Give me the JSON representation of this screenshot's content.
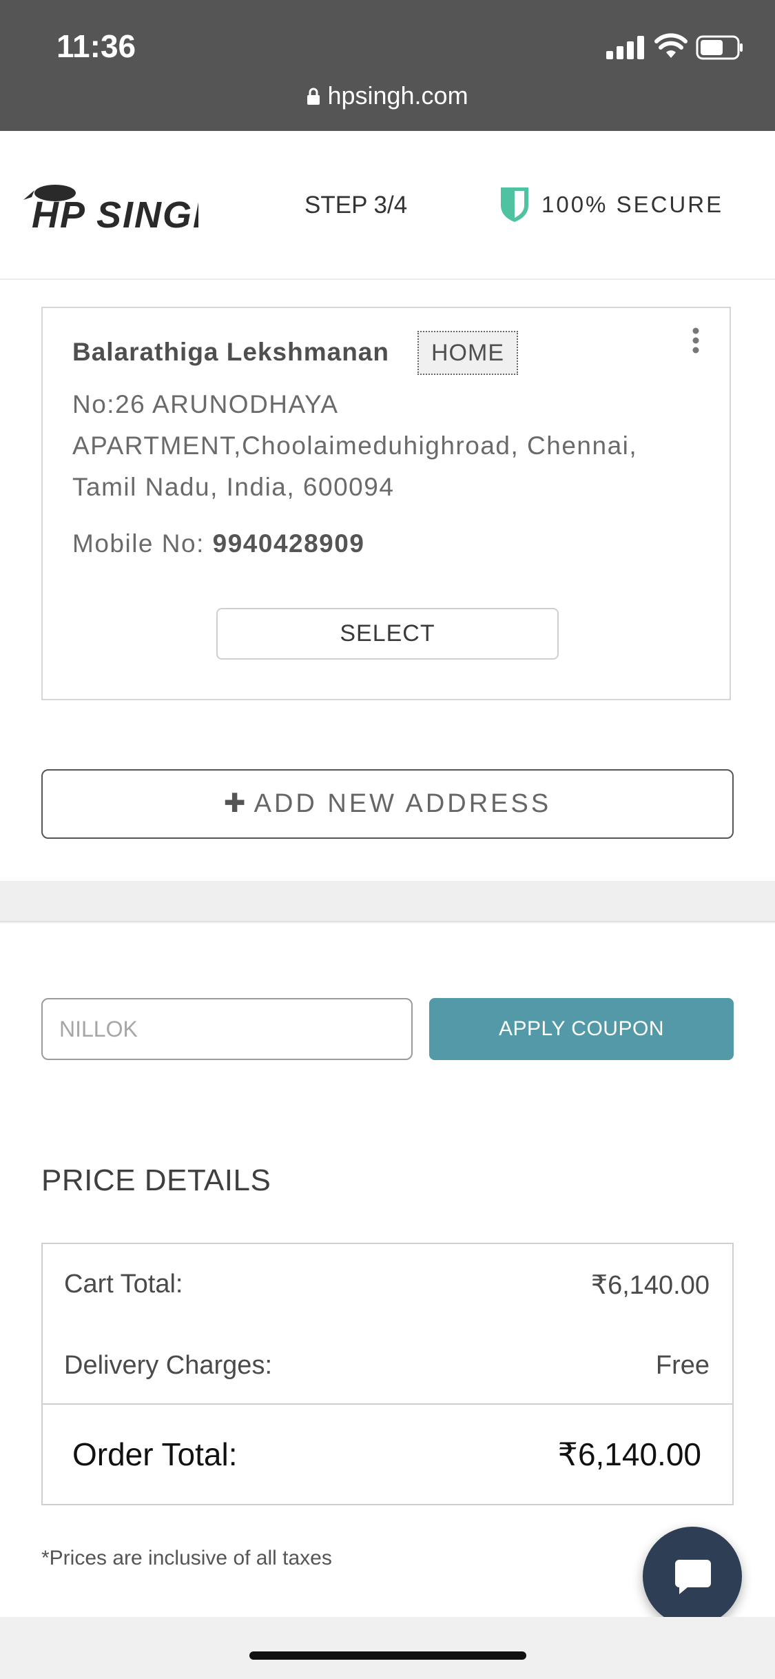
{
  "status_bar": {
    "time": "11:36",
    "url": "hpsingh.com"
  },
  "header": {
    "step": "STEP 3/4",
    "secure": "100% SECURE"
  },
  "address": {
    "name": "Balarathiga Lekshmanan",
    "tag": "HOME",
    "line1": "No:26 ARUNODHAYA",
    "line2": "APARTMENT,Choolaimeduhighroad, Chennai,",
    "line3": "Tamil Nadu, India, 600094",
    "mobile_label": "Mobile No: ",
    "mobile_value": "9940428909",
    "select_label": "SELECT"
  },
  "add_address_label": "ADD NEW ADDRESS",
  "coupon": {
    "placeholder": "NILLOK",
    "apply_label": "APPLY COUPON"
  },
  "price_details": {
    "title": "PRICE DETAILS",
    "cart_total_label": "Cart Total:",
    "cart_total_value": "₹6,140.00",
    "delivery_label": "Delivery Charges:",
    "delivery_value": "Free",
    "order_total_label": "Order Total:",
    "order_total_value": "₹6,140.00",
    "tax_note": "*Prices are inclusive of all taxes"
  },
  "colors": {
    "accent": "#5499a8",
    "shield": "#4fc3a1",
    "chat": "#2d3e55",
    "status_bar": "#555555"
  },
  "icons": [
    "lock-icon",
    "signal-icon",
    "wifi-icon",
    "battery-icon",
    "hpsingh-logo",
    "shield-icon",
    "kebab-menu-icon",
    "plus-icon",
    "chat-icon"
  ]
}
